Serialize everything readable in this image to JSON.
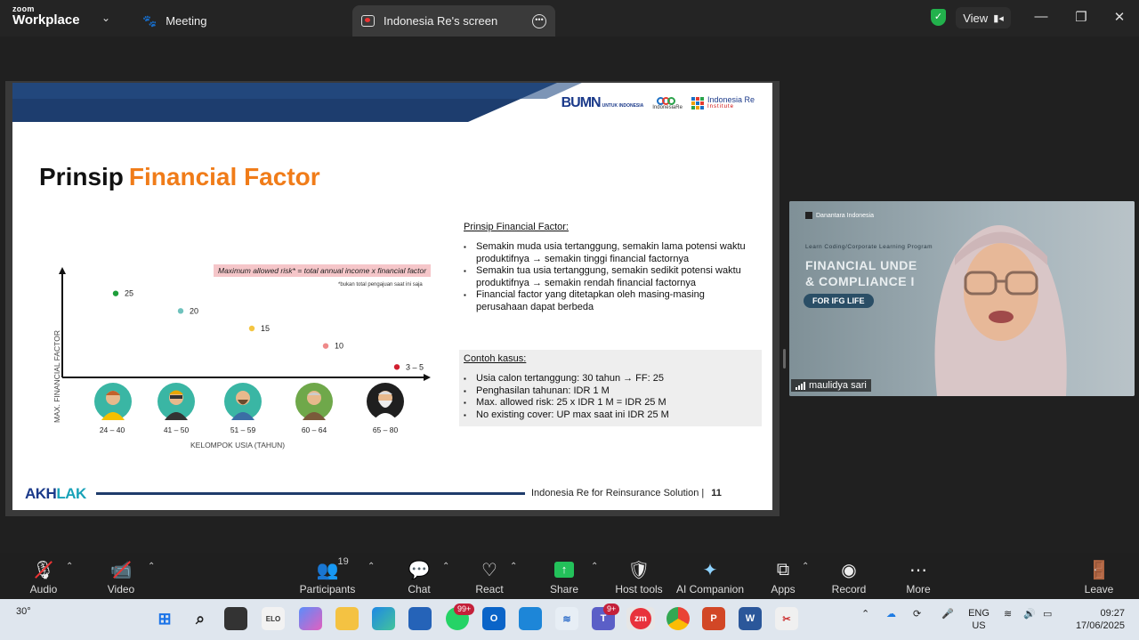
{
  "app": {
    "brand_small": "zoom",
    "brand_large": "Workplace",
    "tabs": [
      {
        "label": "Meeting"
      },
      {
        "label": "Indonesia Re's screen"
      }
    ],
    "view_label": "View"
  },
  "slide": {
    "logos": {
      "bumn": "BUMN",
      "bumn_sub": "UNTUK INDONESIA",
      "ire": "IndonesiaRe",
      "institute_top": "Indonesia Re",
      "institute_bottom": "Institute"
    },
    "title_plain": "Prinsip",
    "title_accent": "Financial Factor",
    "formula": "Maximum allowed risk* = total annual income x financial factor",
    "formula_note": "*bukan total pengajuan saat ini saja",
    "y_axis_label": "MAX. FINANCIAL FACTOR",
    "x_axis_label": "KELOMPOK USIA (TAHUN)",
    "prinsip_heading": "Prinsip Financial Factor:",
    "prinsip_points": [
      "Semakin muda usia tertanggung, semakin lama potensi waktu produktifnya → semakin tinggi financial factornya",
      "Semakin tua usia tertanggung, semakin sedikit potensi waktu produktifnya → semakin rendah financial factornya",
      "Financial factor yang ditetapkan oleh masing-masing perusahaan dapat berbeda"
    ],
    "kasus_heading": "Contoh kasus:",
    "kasus_points": [
      "Usia calon tertanggung: 30 tahun → FF: 25",
      "Penghasilan tahunan: IDR 1 M",
      "Max. allowed risk: 25 x IDR 1 M = IDR 25 M",
      "No existing cover: UP max saat ini IDR 25 M"
    ],
    "footer_brand_a": "AKH",
    "footer_brand_b": "LAK",
    "footer_text": "Indonesia Re for Reinsurance Solution  |",
    "page_number": "11"
  },
  "chart_data": {
    "type": "scatter",
    "categories": [
      "24 – 40",
      "41 – 50",
      "51 – 59",
      "60 – 64",
      "65 – 80"
    ],
    "point_labels": [
      "25",
      "20",
      "15",
      "10",
      "3 – 5"
    ],
    "values": [
      25,
      20,
      15,
      10,
      4
    ],
    "ylim": [
      0,
      30
    ],
    "point_colors": [
      "#1e9e3a",
      "#6fc2bd",
      "#f4c542",
      "#ef8a8a",
      "#d11f2f"
    ],
    "xlabel": "KELOMPOK USIA (TAHUN)",
    "ylabel": "MAX. FINANCIAL FACTOR"
  },
  "video": {
    "bg_line1": "Learn Coding/Corporate Learning Program",
    "bg_line2": "FINANCIAL UNDE",
    "bg_line3": "& COMPLIANCE I",
    "bg_pill": "FOR IFG LIFE",
    "bg_org": "Danantara Indonesia",
    "participant_name": "maulidya sari"
  },
  "toolbar": {
    "audio": "Audio",
    "video": "Video",
    "participants": "Participants",
    "participants_count": "19",
    "chat": "Chat",
    "react": "React",
    "share": "Share",
    "host_tools": "Host tools",
    "ai_companion": "AI Companion",
    "apps": "Apps",
    "record": "Record",
    "more": "More",
    "leave": "Leave"
  },
  "taskbar": {
    "weather": "30°",
    "whatsapp_badge": "99+",
    "teams_badge": "9+",
    "zoom_label": "zm",
    "lang_top": "ENG",
    "lang_bottom": "US",
    "time": "09:27",
    "date": "17/06/2025"
  }
}
